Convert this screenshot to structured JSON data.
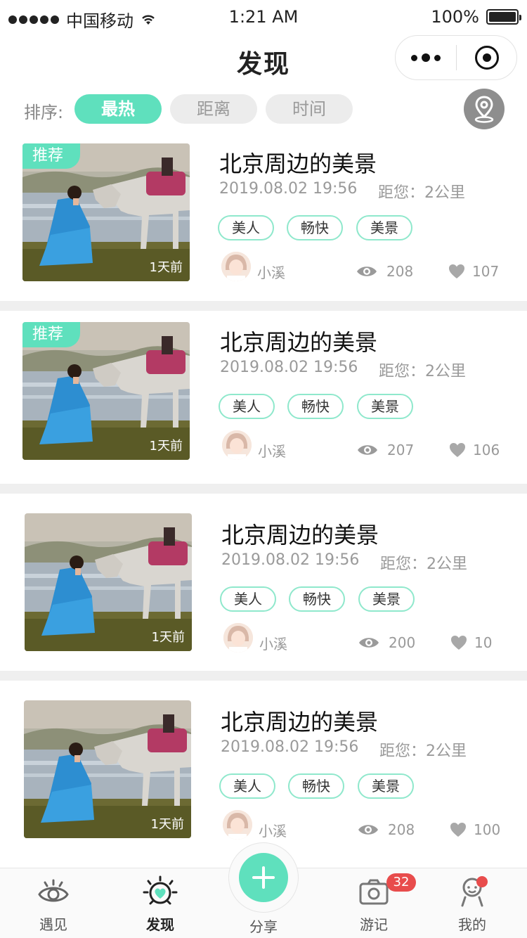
{
  "status_bar": {
    "carrier": "中国移动",
    "time": "1:21 AM",
    "battery": "100%"
  },
  "nav": {
    "title": "发现"
  },
  "sort": {
    "label": "排序:",
    "options": [
      "最热",
      "距离",
      "时间"
    ],
    "active": "最热"
  },
  "posts": [
    {
      "badge": "推荐",
      "title": "北京周边的美景",
      "datetime": "2019.08.02 19:56",
      "distance": "距您：2公里",
      "tags": [
        "美人",
        "畅快",
        "美景"
      ],
      "time_ago": "1天前",
      "user": "小溪",
      "views": "208",
      "likes": "107"
    },
    {
      "badge": "推荐",
      "title": "北京周边的美景",
      "datetime": "2019.08.02 19:56",
      "distance": "距您：2公里",
      "tags": [
        "美人",
        "畅快",
        "美景"
      ],
      "time_ago": "1天前",
      "user": "小溪",
      "views": "207",
      "likes": "106"
    },
    {
      "badge": "",
      "title": "北京周边的美景",
      "datetime": "2019.08.02 19:56",
      "distance": "距您：2公里",
      "tags": [
        "美人",
        "畅快",
        "美景"
      ],
      "time_ago": "1天前",
      "user": "小溪",
      "views": "200",
      "likes": "10"
    },
    {
      "badge": "",
      "title": "北京周边的美景",
      "datetime": "2019.08.02 19:56",
      "distance": "距您：2公里",
      "tags": [
        "美人",
        "畅快",
        "美景"
      ],
      "time_ago": "1天前",
      "user": "小溪",
      "views": "208",
      "likes": "100"
    }
  ],
  "tabbar": {
    "items": [
      {
        "label": "遇见",
        "icon": "eye-icon"
      },
      {
        "label": "发现",
        "icon": "heart-sun-icon"
      },
      {
        "label": "分享",
        "icon": "plus-icon"
      },
      {
        "label": "游记",
        "icon": "camera-icon",
        "badge": "32"
      },
      {
        "label": "我的",
        "icon": "profile-icon"
      }
    ]
  },
  "colors": {
    "accent": "#5fe0bd",
    "badge": "#e84c4c"
  }
}
